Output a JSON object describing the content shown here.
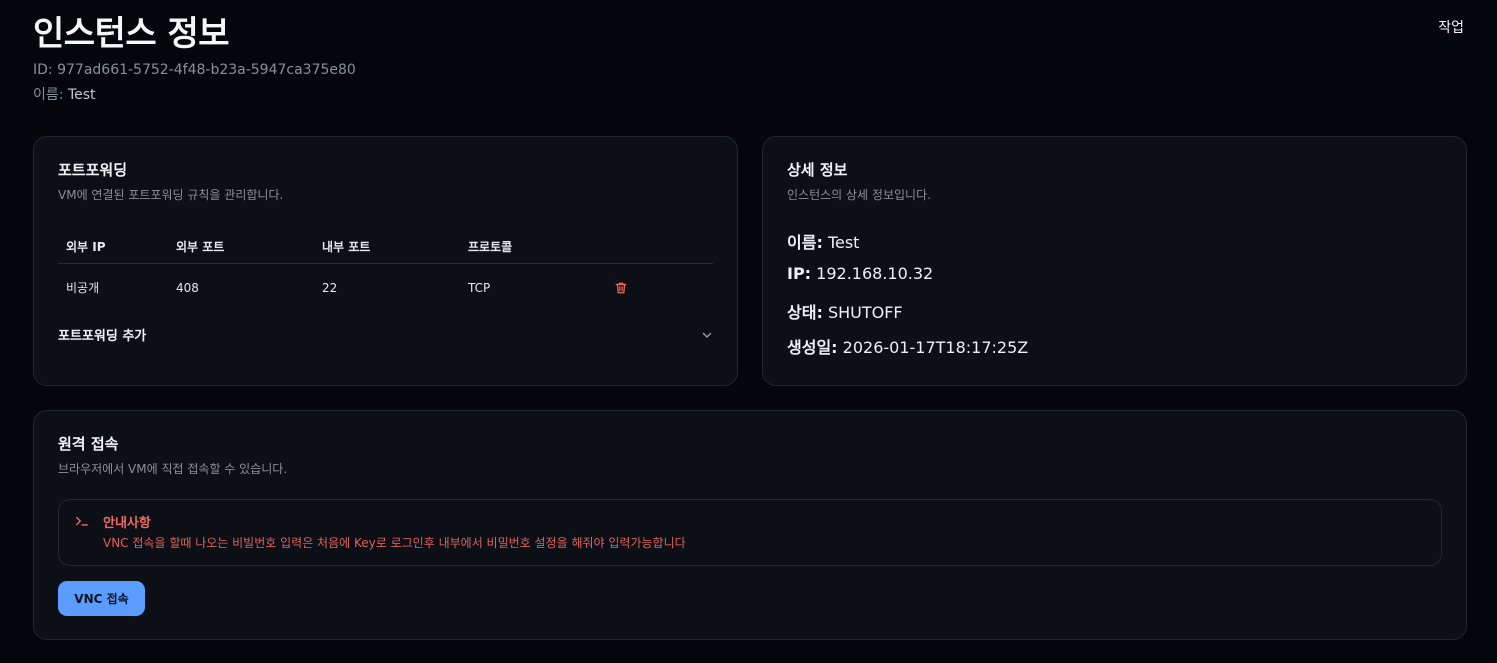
{
  "header": {
    "title": "인스턴스 정보",
    "actions_label": "작업",
    "id_label": "ID:",
    "id_value": "977ad661-5752-4f48-b23a-5947ca375e80",
    "name_label": "이름:",
    "name_value": "Test"
  },
  "port_forwarding": {
    "title": "포트포워딩",
    "subtitle": "VM에 연결된 포트포워딩 규칙을 관리합니다.",
    "columns": [
      "외부 IP",
      "외부 포트",
      "내부 포트",
      "프로토콜"
    ],
    "rows": [
      {
        "external_ip": "비공개",
        "external_port": "408",
        "internal_port": "22",
        "protocol": "TCP"
      }
    ],
    "add_label": "포트포워딩 추가",
    "delete_icon": "trash-icon",
    "expand_icon": "chevron-down-icon"
  },
  "details": {
    "title": "상세 정보",
    "subtitle": "인스턴스의 상세 정보입니다.",
    "items": [
      {
        "label": "이름:",
        "value": "Test"
      },
      {
        "label": "IP:",
        "value": "192.168.10.32"
      },
      {
        "label": "상태:",
        "value": "SHUTOFF"
      },
      {
        "label": "생성일:",
        "value": "2026-01-17T18:17:25Z"
      }
    ]
  },
  "remote": {
    "title": "원격 접속",
    "subtitle": "브라우저에서 VM에 직접 접속할 수 있습니다.",
    "notice_icon": "terminal-icon",
    "notice_title": "안내사항",
    "notice_text": "VNC 접속을 할때 나오는 비빌번호 입력은 처음에 Key로 로그인후 내부에서 비밀번호 설정을 해줘야 입력가능합니다",
    "vnc_button": "VNC 접속"
  },
  "colors": {
    "background": "#05060b",
    "card": "#0c0f16",
    "accent": "#5b9cff",
    "danger": "#f06a63"
  }
}
